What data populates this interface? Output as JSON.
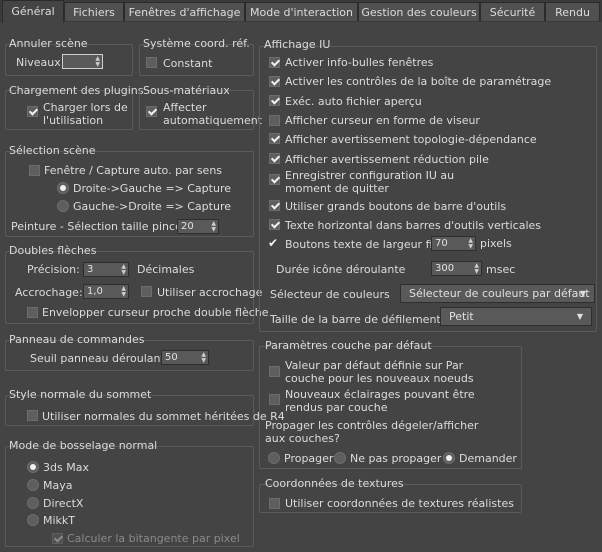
{
  "tabs": [
    "Général",
    "Fichiers",
    "Fenêtres d'affichage",
    "Mode d'interaction",
    "Gestion des couleurs",
    "Sécurité",
    "Rendu"
  ],
  "annuler": {
    "title": "Annuler scène",
    "niveaux_label": "Niveaux:",
    "niveaux_value": ""
  },
  "systeme": {
    "title": "Système coord. réf.",
    "constant": "Constant"
  },
  "plugins": {
    "title": "Chargement des plugins",
    "line1": "Charger lors de",
    "line2": "l'utilisation"
  },
  "sousmat": {
    "title": "Sous-matériaux",
    "line1": "Affecter",
    "line2": "automatiquement"
  },
  "selection": {
    "title": "Sélection scène",
    "fenetre": "Fenêtre / Capture auto. par sens",
    "droite_gauche": "Droite->Gauche => Capture",
    "gauche_droite": "Gauche->Droite => Capture",
    "peinture_label": "Peinture - Sélection taille pinceau",
    "peinture_value": "20"
  },
  "doubles": {
    "title": "Doubles flèches",
    "precision_label": "Précision:",
    "precision_value": "3",
    "decimales": "Décimales",
    "accrochage_label": "Accrochage:",
    "accrochage_value": "1,0",
    "utiliser_accrochage": "Utiliser accrochage",
    "envelopper": "Envelopper curseur proche double flèche"
  },
  "panneau": {
    "title": "Panneau de commandes",
    "seuil_label": "Seuil panneau déroulant:",
    "seuil_value": "50"
  },
  "style": {
    "title": "Style normale du sommet",
    "utiliser": "Utiliser normales du sommet héritées de R4"
  },
  "bosselage": {
    "title": "Mode de bosselage normal",
    "options": [
      "3ds Max",
      "Maya",
      "DirectX",
      "MikkT"
    ],
    "calculer": "Calculer la bitangente par pixel"
  },
  "affichage": {
    "title": "Affichage IU",
    "items": [
      "Activer info-bulles fenêtres",
      "Activer les contrôles de la boîte de paramétrage",
      "Exéc. auto fichier aperçu",
      "Afficher curseur en forme de viseur",
      "Afficher avertissement topologie-dépendance",
      "Afficher avertissement réduction pile",
      "Enregistrer configuration IU au",
      "moment de quitter",
      "Utiliser grands boutons de barre d'outils",
      "Texte horizontal dans barres d'outils verticales",
      "Boutons texte de largeur fixe"
    ],
    "largeur_value": "70",
    "pixels": "pixels",
    "duree_label": "Durée icône déroulante",
    "duree_value": "300",
    "msec": "msec",
    "selecteur_label": "Sélecteur de couleurs",
    "selecteur_value": "Sélecteur de couleurs par défaut",
    "taille_label": "Taille de la barre de défilement",
    "taille_value": "Petit"
  },
  "couche": {
    "title": "Paramètres couche par défaut",
    "valeur1": "Valeur par défaut définie sur Par",
    "valeur2": "couche pour les nouveaux noeuds",
    "nouveaux1": "Nouveaux éclairages pouvant être",
    "nouveaux2": "rendus par couche",
    "propager_q1": "Propager les contrôles dégeler/afficher",
    "propager_q2": "aux couches?",
    "options": [
      "Propager",
      "Ne pas propager",
      "Demander"
    ]
  },
  "textures": {
    "title": "Coordonnées de textures",
    "utiliser": "Utiliser coordonnées de textures réalistes"
  }
}
